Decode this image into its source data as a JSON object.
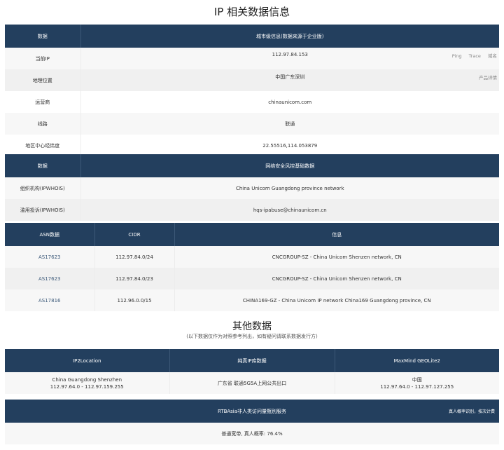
{
  "page": {
    "title": "IP 相关数据信息",
    "other_title": "其他数据",
    "other_note": "(以下数据仅作为对照参考列出，如有疑问请联系数据发行方)"
  },
  "city_table": {
    "header_left": "数据",
    "header_right": "城市级信息(数据来源于企业版)",
    "rows": [
      {
        "label": "当前IP",
        "value": "112.97.84.153"
      },
      {
        "label": "地理位置",
        "value": "中国广东深圳"
      },
      {
        "label": "运营商",
        "value": "chinaunicom.com"
      },
      {
        "label": "线路",
        "value": "联通"
      },
      {
        "label": "地区中心经纬度",
        "value": "22.55516,114.053879"
      }
    ],
    "ip_links": [
      "Ping",
      "Trace",
      "域名"
    ],
    "location_link": "产品详情"
  },
  "security_table": {
    "header_left": "数据",
    "header_right": "网络安全风控基础数据",
    "rows": [
      {
        "label": "组织机构(IPWHOIS)",
        "value": "China Unicom Guangdong province network"
      },
      {
        "label": "滥用投诉(IPWHOIS)",
        "value": "hqs-ipabuse@chinaunicom.cn"
      }
    ]
  },
  "asn_table": {
    "headers": [
      "ASN数据",
      "CIDR",
      "信息"
    ],
    "rows": [
      {
        "asn": "AS17623",
        "cidr": "112.97.84.0/24",
        "info": "CNCGROUP-SZ - China Unicom Shenzen network, CN"
      },
      {
        "asn": "AS17623",
        "cidr": "112.97.84.0/23",
        "info": "CNCGROUP-SZ - China Unicom Shenzen network, CN"
      },
      {
        "asn": "AS17816",
        "cidr": "112.96.0.0/15",
        "info": "CHINA169-GZ - China Unicom IP network China169 Guangdong province, CN"
      }
    ]
  },
  "other_table": {
    "headers": [
      "IP2Location",
      "纯真IP库数据",
      "MaxMind GEOLite2"
    ],
    "ip2location_line1": "China Guangdong Shenzhen",
    "ip2location_line2": "112.97.64.0 - 112.97.159.255",
    "chunzhen": "广东省 联通5G5A上网公共出口",
    "maxmind_line1": "中国",
    "maxmind_line2": "112.97.64.0 - 112.97.127.255"
  },
  "rtb_table": {
    "header": "RTBAsia非人类访问量甄别服务",
    "header_note": "真人概率识别，按次计费",
    "value": "普通宽带, 真人概率: 76.4%"
  }
}
